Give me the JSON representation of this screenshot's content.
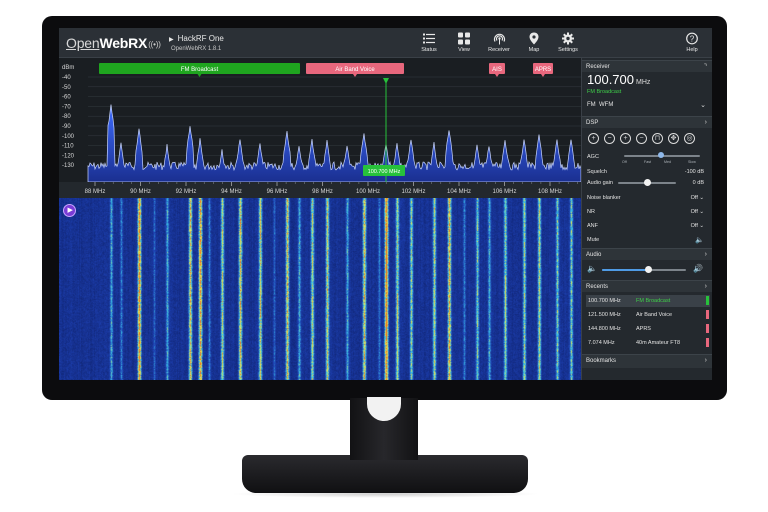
{
  "app": {
    "logo_open": "Open",
    "logo_web": "WebRX",
    "device_name": "HackRF One",
    "version": "OpenWebRX 1.8.1"
  },
  "nav": [
    {
      "label": "Status",
      "icon": "list-icon"
    },
    {
      "label": "View",
      "icon": "grid-icon"
    },
    {
      "label": "Receiver",
      "icon": "antenna-icon"
    },
    {
      "label": "Map",
      "icon": "map-pin-icon"
    },
    {
      "label": "Settings",
      "icon": "gear-icon"
    },
    {
      "label": "Help",
      "icon": "help-icon"
    }
  ],
  "spectrum": {
    "unit": "dBm",
    "db_ticks": [
      "-40",
      "-50",
      "-60",
      "-70",
      "-80",
      "-90",
      "-100",
      "-110",
      "-120",
      "-130"
    ],
    "freq_ticks": [
      "88 MHz",
      "90 MHz",
      "92 MHz",
      "94 MHz",
      "96 MHz",
      "98 MHz",
      "100 MHz",
      "102 MHz",
      "104 MHz",
      "106 MHz",
      "108 MHz"
    ],
    "bands": [
      {
        "label": "FM Broadcast",
        "color": "#1fa51f"
      },
      {
        "label": "Air Band Voice",
        "color": "#e8677d"
      },
      {
        "label": "AIS",
        "color": "#e8677d"
      },
      {
        "label": "APRS",
        "color": "#e8677d"
      }
    ],
    "tuned_label": "100.700 MHz"
  },
  "panel": {
    "receiver": {
      "title": "Receiver",
      "frequency": "100.700",
      "unit": "MHz",
      "band": "FM Broadcast",
      "mode": "FM",
      "submode": "WFM"
    },
    "dsp": {
      "title": "DSP",
      "agc_label": "AGC",
      "agc_options": [
        "Off",
        "Fast",
        "Med",
        "Slow"
      ],
      "squelch_label": "Squelch",
      "squelch_value": "-100 dB",
      "audio_gain_label": "Audio gain",
      "audio_gain_value": "0 dB",
      "noise_blanker_label": "Noise blanker",
      "noise_blanker_value": "Off",
      "nr_label": "NR",
      "nr_value": "Off",
      "anf_label": "ANF",
      "anf_value": "Off",
      "mute_label": "Mute"
    },
    "audio": {
      "title": "Audio",
      "volume": 0.55
    },
    "recents": {
      "title": "Recents",
      "items": [
        {
          "freq": "100.700 MHz",
          "name": "FM Broadcast",
          "color": "#27c13b"
        },
        {
          "freq": "121.500 MHz",
          "name": "Air Band Voice",
          "color": "#e8677d"
        },
        {
          "freq": "144.800 MHz",
          "name": "APRS",
          "color": "#e8677d"
        },
        {
          "freq": "7.074 MHz",
          "name": "40m Amateur FT8",
          "color": "#e8677d"
        }
      ]
    },
    "bookmarks": {
      "title": "Bookmarks"
    }
  },
  "colors": {
    "accent": "#f5d020",
    "signal_green": "#27c13b",
    "bookmark_pink": "#e8677d",
    "spectrum_fill": "#1f3fa8"
  }
}
